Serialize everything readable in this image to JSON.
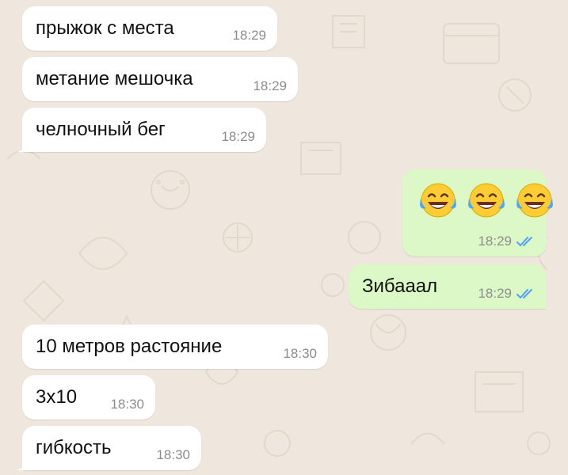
{
  "colors": {
    "background": "#efe7dd",
    "incoming_bubble": "#ffffff",
    "outgoing_bubble": "#dcf8c6",
    "timestamp": "#8c8c8c",
    "read_ticks": "#4fa3f7"
  },
  "messages": [
    {
      "direction": "incoming",
      "text": "прыжок с места",
      "time": "18:29"
    },
    {
      "direction": "incoming",
      "text": "метание мешочка",
      "time": "18:29"
    },
    {
      "direction": "incoming",
      "text": "челночный бег",
      "time": "18:29"
    },
    {
      "direction": "outgoing",
      "emoji": [
        "laughing-tears-emoji",
        "laughing-tears-emoji",
        "laughing-tears-emoji"
      ],
      "time": "18:29",
      "status": "read"
    },
    {
      "direction": "outgoing",
      "text": "Зибааал",
      "time": "18:29",
      "status": "read"
    },
    {
      "direction": "incoming",
      "text": "10 метров растояние",
      "time": "18:30"
    },
    {
      "direction": "incoming",
      "text": "3x10",
      "time": "18:30"
    },
    {
      "direction": "incoming",
      "text": "гибкость",
      "time": "18:30"
    }
  ]
}
